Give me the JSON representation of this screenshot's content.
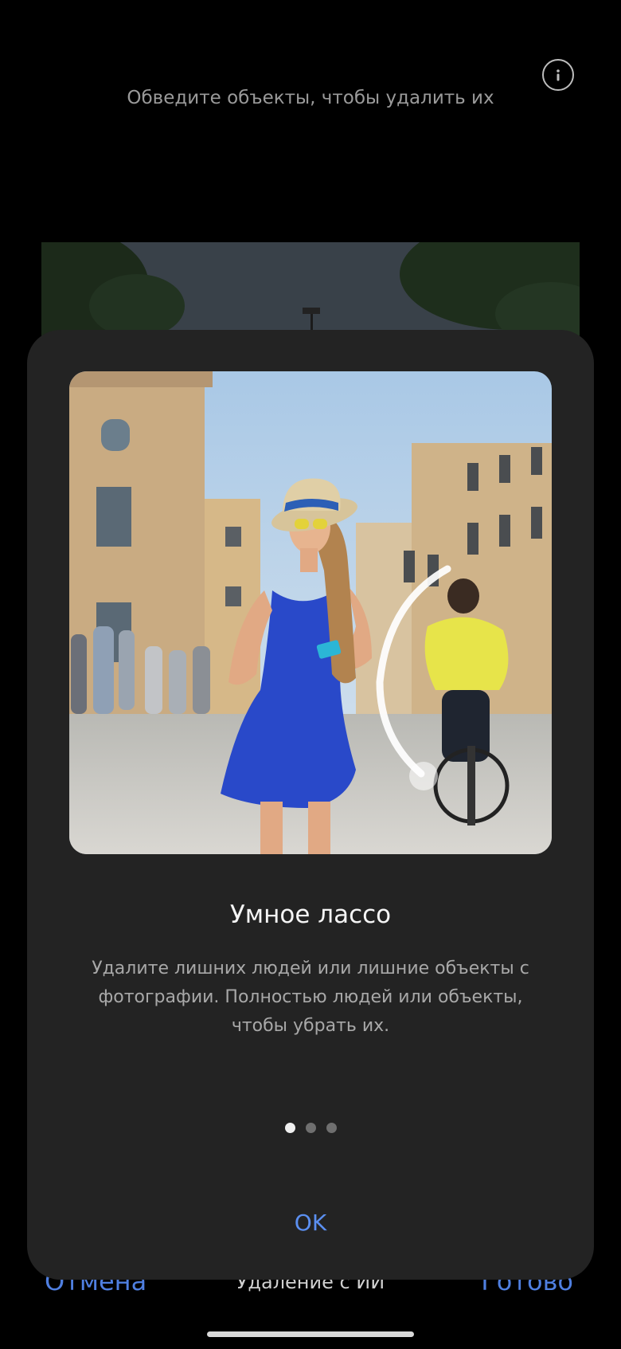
{
  "header": {
    "hint": "Обведите объекты, чтобы удалить их",
    "info_icon": "info-icon"
  },
  "toolbar": {
    "cancel_label": "Отмена",
    "mode_label": "Удаление с ИИ",
    "done_label": "Готово"
  },
  "dialog": {
    "title": "Умное лассо",
    "description": "Удалите лишних людей или лишние объекты с фотографии. Полностью людей или объекты, чтобы убрать их.",
    "pages_total": 3,
    "active_page": 1,
    "ok_label": "OK"
  },
  "colors": {
    "accent": "#5b8ff0",
    "sheet": "#232323",
    "background": "#000000"
  }
}
